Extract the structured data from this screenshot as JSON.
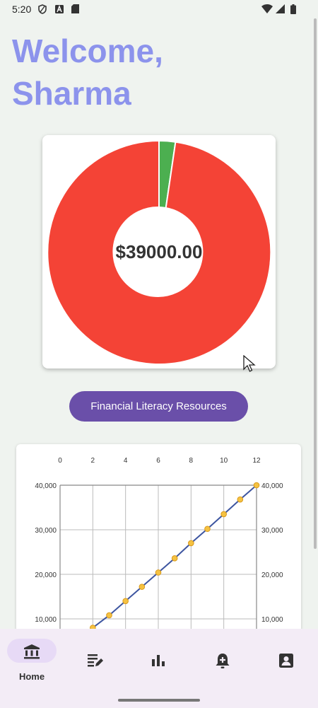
{
  "status_bar": {
    "time": "5:20",
    "icons": [
      "shield-icon",
      "a-icon",
      "sd-card-icon",
      "wifi-icon",
      "signal-icon",
      "battery-icon"
    ]
  },
  "welcome": {
    "line1": "Welcome,",
    "line2": "Sharma",
    "color": "#8c93ec"
  },
  "donut": {
    "center_text": "$39000.00",
    "colors": [
      "#4caf50",
      "#f44336"
    ]
  },
  "resources_button": {
    "label": "Financial Literacy Resources",
    "color": "#6a4fa9"
  },
  "chart_data": {
    "type": "line",
    "x_axis_ticks": [
      "0",
      "2",
      "4",
      "6",
      "8",
      "10",
      "12"
    ],
    "y_axis_ticks": [
      "10,000",
      "20,000",
      "30,000",
      "40,000"
    ],
    "xlim": [
      0,
      12
    ],
    "grid": true,
    "x": [
      2,
      3,
      4,
      5,
      6,
      7,
      8,
      9,
      10,
      11,
      12
    ],
    "y": [
      8000,
      10800,
      14000,
      17200,
      20400,
      23600,
      27000,
      30200,
      33500,
      36800,
      40000
    ],
    "line_color": "#3d55a0",
    "marker_color": "#f5c242"
  },
  "bottom_nav": {
    "items": [
      {
        "icon": "bank-icon",
        "label": "Home"
      },
      {
        "icon": "edit-note-icon",
        "label": ""
      },
      {
        "icon": "bar-chart-icon",
        "label": ""
      },
      {
        "icon": "notification-add-icon",
        "label": ""
      },
      {
        "icon": "contact-icon",
        "label": ""
      }
    ]
  }
}
